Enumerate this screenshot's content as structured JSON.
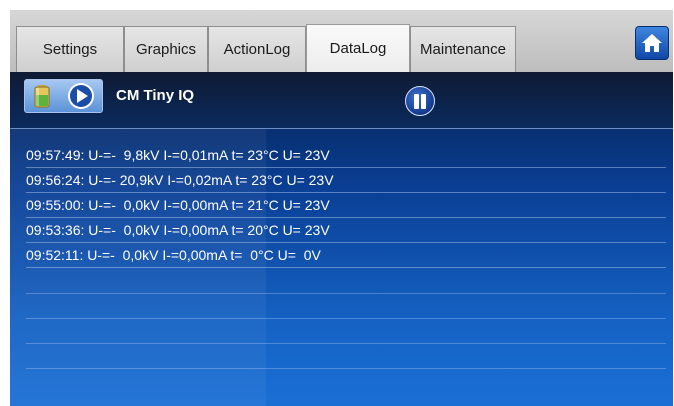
{
  "tabs": [
    {
      "label": "Settings",
      "active": false
    },
    {
      "label": "Graphics",
      "active": false
    },
    {
      "label": "ActionLog",
      "active": false
    },
    {
      "label": "DataLog",
      "active": true
    },
    {
      "label": "Maintenance",
      "active": false
    }
  ],
  "home": {
    "icon": "home-icon"
  },
  "toolbar": {
    "device_icon": "battery-icon",
    "play_icon": "play-icon",
    "device_name": "CM Tiny IQ",
    "pause_icon": "pause-icon"
  },
  "log": {
    "rows": [
      "09:57:49: U-=-  9,8kV I-=0,01mA t= 23°C U= 23V",
      "09:56:24: U-=- 20,9kV I-=0,02mA t= 23°C U= 23V",
      "09:55:00: U-=-  0,0kV I-=0,00mA t= 21°C U= 23V",
      "09:53:36: U-=-  0,0kV I-=0,00mA t= 20°C U= 23V",
      "09:52:11: U-=-  0,0kV I-=0,00mA t=  0°C U=  0V"
    ]
  },
  "colors": {
    "panel_top": "#05204f",
    "panel_bottom": "#1a6fd5",
    "home_button": "#1a5fc4"
  }
}
